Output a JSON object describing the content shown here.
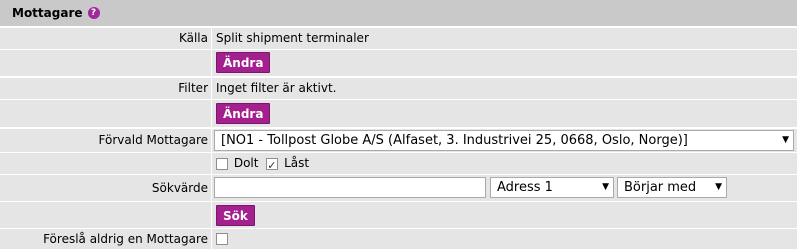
{
  "header": {
    "title": "Mottagare"
  },
  "source": {
    "label": "Källa",
    "value": "Split shipment terminaler",
    "change_button": "Ändra"
  },
  "filter": {
    "label": "Filter",
    "value": "Inget filter är aktivt.",
    "change_button": "Ändra"
  },
  "default_recipient": {
    "label": "Förvald Mottagare",
    "selected": "[NO1 - Tollpost Globe A/S (Alfaset, 3. Industrivei 25, 0668, Oslo, Norge)]",
    "hidden_label": "Dolt",
    "hidden_checked": false,
    "locked_label": "Låst",
    "locked_checked": true
  },
  "search": {
    "label": "Sökvärde",
    "value": "",
    "field_select": "Adress 1",
    "match_select": "Börjar med",
    "search_button": "Sök"
  },
  "never_suggest": {
    "label": "Föreslå aldrig en Mottagare",
    "checked": false
  }
}
